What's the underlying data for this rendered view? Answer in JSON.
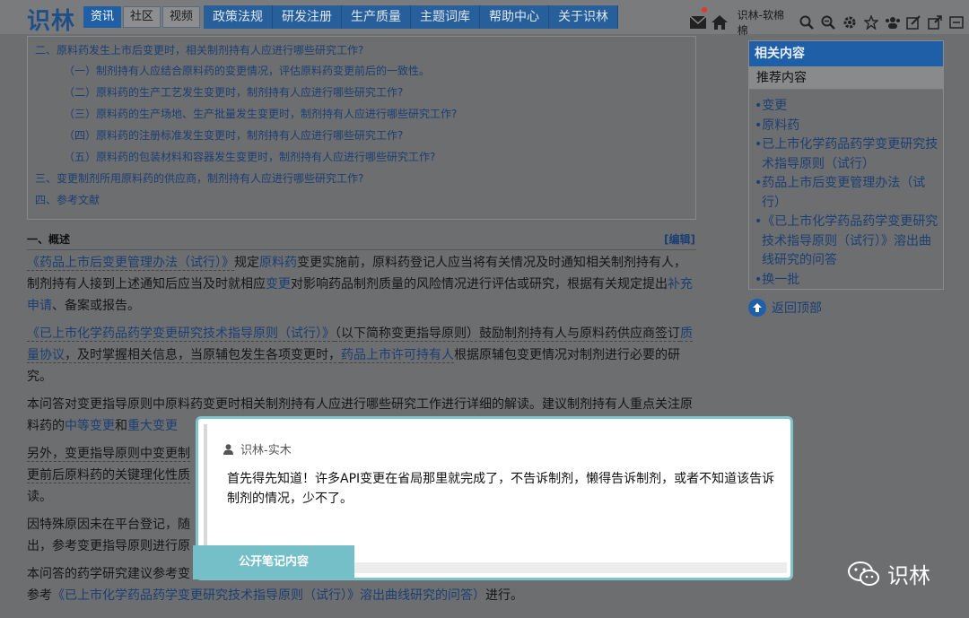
{
  "header": {
    "logo": "识林",
    "subtabs": [
      "资讯",
      "社区",
      "视频"
    ],
    "nav": [
      "政策法规",
      "研发注册",
      "生产质量",
      "主题词库",
      "帮助中心",
      "关于识林"
    ],
    "user": "识林-软棉棉"
  },
  "toc": {
    "items": [
      "二、原料药发生上市后变更时，相关制剂持有人应进行哪些研究工作?",
      "（一）制剂持有人应结合原料药的变更情况，评估原料药变更前后的一致性。",
      "（二）原料药的生产工艺发生变更时，制剂持有人应进行哪些研究工作?",
      "（三）原料药的生产场地、生产批量发生变更时，制剂持有人应进行哪些研究工作?",
      "（四）原料药的注册标准发生变更时，制剂持有人应进行哪些研究工作?",
      "（五）原料药的包装材料和容器发生变更时，制剂持有人应进行哪些研究工作?",
      "三、变更制剂所用原料药的供应商，制剂持有人应进行哪些研究工作?",
      "四、参考文献"
    ]
  },
  "section": {
    "title": "一、概述",
    "edit": "[编辑]"
  },
  "paragraphs": {
    "p1": {
      "a": "《药品上市后变更管理办法（试行）》",
      "b": "规定",
      "c": "原料药",
      "d": "变更实施前，原料药登记人应当将有关情况及时通知相关制剂持有人，制剂持有人接到上述通知后应当及时就相应",
      "e": "变更",
      "f": "对影响药品制剂质量的风险情况进行评估或研究，根据有关规定提出",
      "g": "补充申请",
      "h": "、备案或报告。"
    },
    "p2": {
      "a": "《已上市化学药品药学变更研究技术指导原则（试行）》",
      "b": "（以下简称变更指导原则）鼓励制剂持有人与原料药供应商签订",
      "c": "质量协议",
      "d": "，及时掌握相关信息，当原辅包发生各项变更时，",
      "e": "药品上市许可持有人",
      "f": "根据原辅包变更情况对制剂进行必要的研究。"
    },
    "p3": {
      "a": "本问答对变更指导原则中原料药变更时相关制剂持有人应进行哪些研究工作进行详细的解读。建议制剂持有人重点关注原料药的",
      "b": "中等变更",
      "c": "和",
      "d": "重大变更"
    },
    "p4": {
      "a": "另外，变更指导原则中变更制",
      "b": "更前后原料药的关键理化性质",
      "c": "读。"
    },
    "p5": {
      "a": "因特殊原因未在平台登记，随",
      "b": "出，参考变更指导原则进行原"
    },
    "p6": {
      "a": "本问答的药学研究建议参考变"
    },
    "p7": {
      "a": "参考",
      "b": "《已上市化学药品药学变更研究技术指导原则（试行）》",
      "c": "溶出曲线研究的问答",
      "d": "）",
      "e": "进行。"
    }
  },
  "sidebar": {
    "heading": "相关内容",
    "sub": "推荐内容",
    "items": [
      "•变更",
      "•原料药",
      "•已上市化学药品药学变更研究技术指导原则（试行）",
      "•药品上市后变更管理办法（试行）",
      "•《已上市化学药品药学变更研究技术指导原则（试行）》溶出曲线研究的问答",
      "•换一批"
    ],
    "back_top": "返回顶部"
  },
  "modal": {
    "author": "识林-实木",
    "text": "首先得先知道！许多API变更在省局那里就完成了，不告诉制剂，懒得告诉制剂，或者不知道该告诉制剂的情况，少不了。",
    "button": "公开笔记内容"
  },
  "watermark": "识林",
  "colors": {
    "brand": "#1e5fa8",
    "accent": "#74bfc8",
    "overlay": "#6d6e70"
  }
}
